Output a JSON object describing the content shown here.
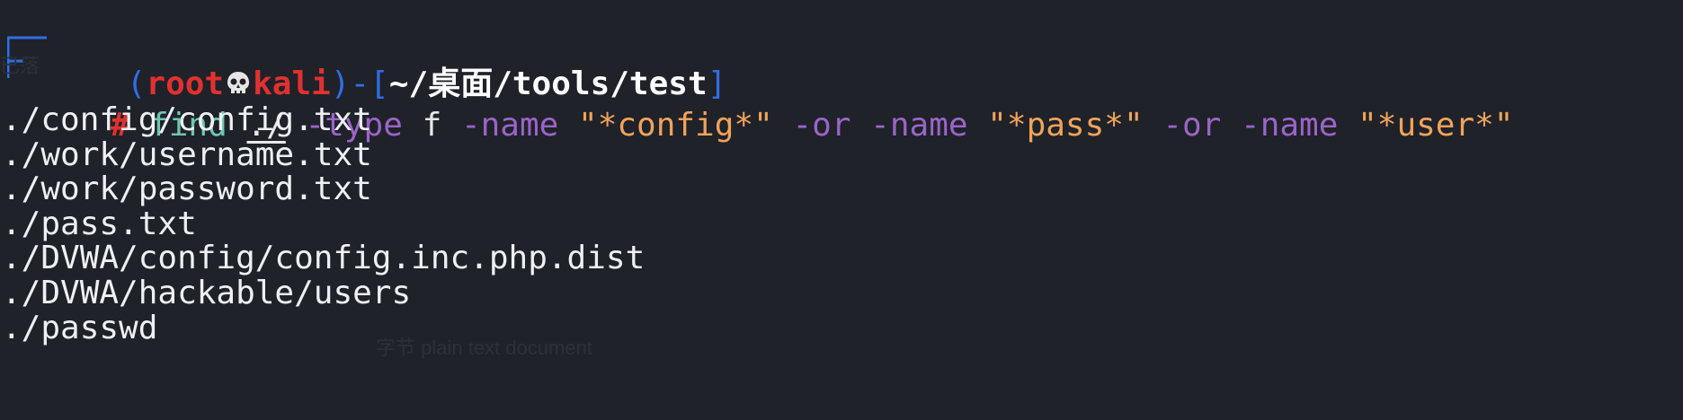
{
  "colors": {
    "background": "#1f2229",
    "blue": "#2f6fe4",
    "red": "#e03131",
    "command": "#6fc7b0",
    "flag": "#9b64c8",
    "string": "#f0a35a",
    "text": "#eef0f4"
  },
  "prompt": {
    "open_paren": "(",
    "user": "root",
    "separator_icon": "skull-icon",
    "host": "kali",
    "close_paren": ")",
    "dash": "-",
    "open_bracket": "[",
    "cwd": "~/桌面/tools/test",
    "close_bracket": "]",
    "symbol": "#"
  },
  "command": {
    "program": "find",
    "path": "./",
    "tokens": [
      {
        "text": "-type",
        "kind": "flag"
      },
      {
        "text": "f",
        "kind": "plain"
      },
      {
        "text": "-name",
        "kind": "flag"
      },
      {
        "text": "\"*config*\"",
        "kind": "string"
      },
      {
        "text": "-or",
        "kind": "flag"
      },
      {
        "text": "-name",
        "kind": "flag"
      },
      {
        "text": "\"*pass*\"",
        "kind": "string"
      },
      {
        "text": "-or",
        "kind": "flag"
      },
      {
        "text": "-name",
        "kind": "flag"
      },
      {
        "text": "\"*user*\"",
        "kind": "string"
      }
    ]
  },
  "output": [
    "./config/config.txt",
    "./work/username.txt",
    "./work/password.txt",
    "./pass.txt",
    "./DVWA/config/config.inc.php.dist",
    "./DVWA/hackable/users",
    "./passwd"
  ],
  "ghost_text": {
    "left": "已落",
    "bottom": "字节 plain text document"
  }
}
